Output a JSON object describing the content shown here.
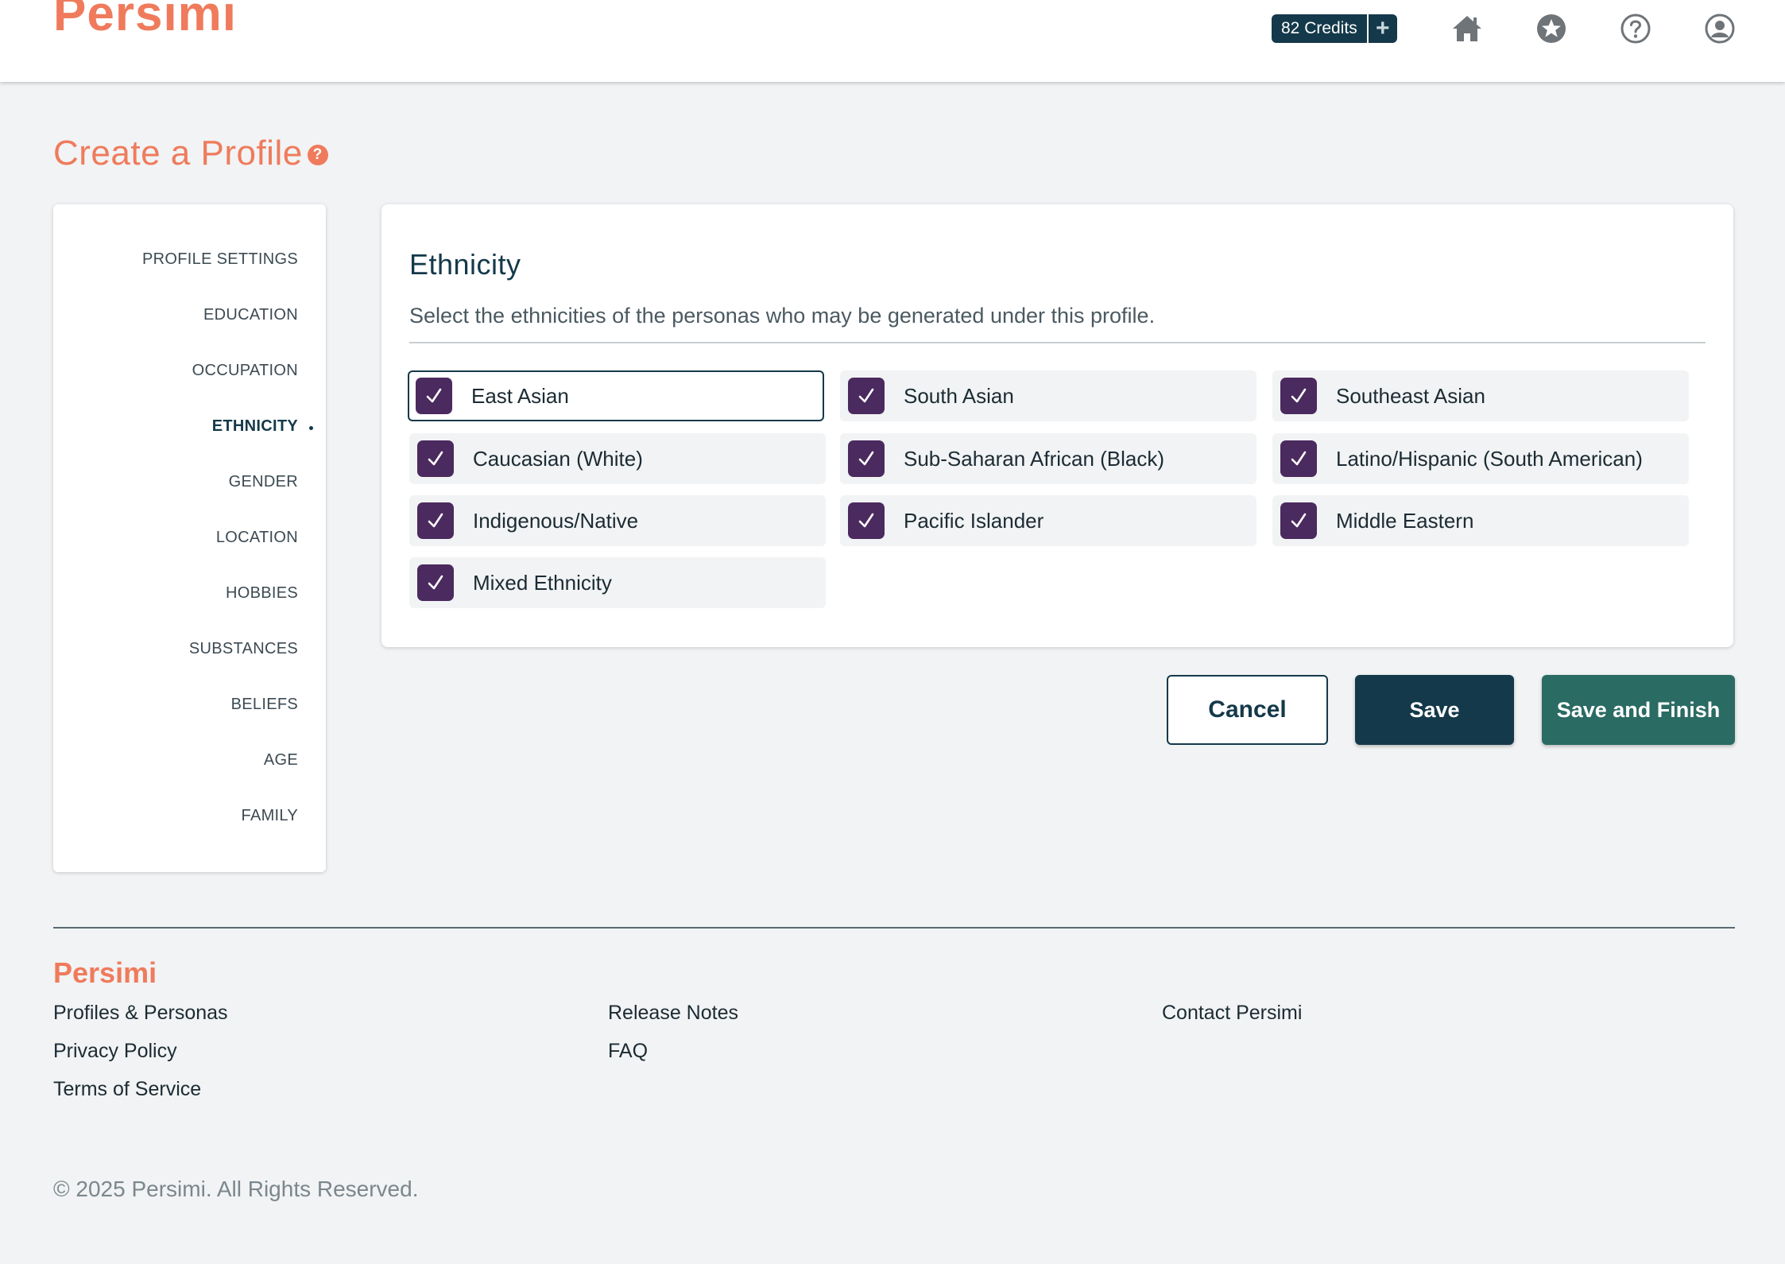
{
  "header": {
    "logo": "Persimi",
    "credits_label": "82 Credits",
    "credits_add": "+",
    "nav_icons": [
      "home-icon",
      "star-icon",
      "help-icon",
      "account-icon"
    ]
  },
  "page": {
    "title": "Create a Profile",
    "title_help": "?"
  },
  "sidebar": {
    "items": [
      {
        "label": "PROFILE SETTINGS",
        "active": false
      },
      {
        "label": "EDUCATION",
        "active": false
      },
      {
        "label": "OCCUPATION",
        "active": false
      },
      {
        "label": "ETHNICITY",
        "active": true
      },
      {
        "label": "GENDER",
        "active": false
      },
      {
        "label": "LOCATION",
        "active": false
      },
      {
        "label": "HOBBIES",
        "active": false
      },
      {
        "label": "SUBSTANCES",
        "active": false
      },
      {
        "label": "BELIEFS",
        "active": false
      },
      {
        "label": "AGE",
        "active": false
      },
      {
        "label": "FAMILY",
        "active": false
      }
    ]
  },
  "ethnicity": {
    "title": "Ethnicity",
    "description": "Select the ethnicities of the personas who may be generated under this profile.",
    "options": [
      {
        "label": "East Asian",
        "checked": true
      },
      {
        "label": "South Asian",
        "checked": true
      },
      {
        "label": "Southeast Asian",
        "checked": true
      },
      {
        "label": "Caucasian (White)",
        "checked": true
      },
      {
        "label": "Sub-Saharan African (Black)",
        "checked": true
      },
      {
        "label": "Latino/Hispanic (South American)",
        "checked": true
      },
      {
        "label": "Indigenous/Native",
        "checked": true
      },
      {
        "label": "Pacific Islander",
        "checked": true
      },
      {
        "label": "Middle Eastern",
        "checked": true
      },
      {
        "label": "Mixed Ethnicity",
        "checked": true
      }
    ]
  },
  "actions": {
    "cancel": "Cancel",
    "save": "Save",
    "save_finish": "Save and Finish"
  },
  "footer": {
    "logo": "Persimi",
    "links": {
      "profiles": "Profiles & Personas",
      "privacy": "Privacy Policy",
      "terms": "Terms of Service",
      "release_notes": "Release Notes",
      "faq": "FAQ",
      "contact": "Contact Persimi"
    },
    "copyright": "© 2025 Persimi. All Rights Reserved."
  },
  "colors": {
    "brand_orange": "#ef7b5c",
    "navy": "#14394a",
    "teal": "#2a6b63",
    "checkbox_purple": "#4b2a5f"
  }
}
